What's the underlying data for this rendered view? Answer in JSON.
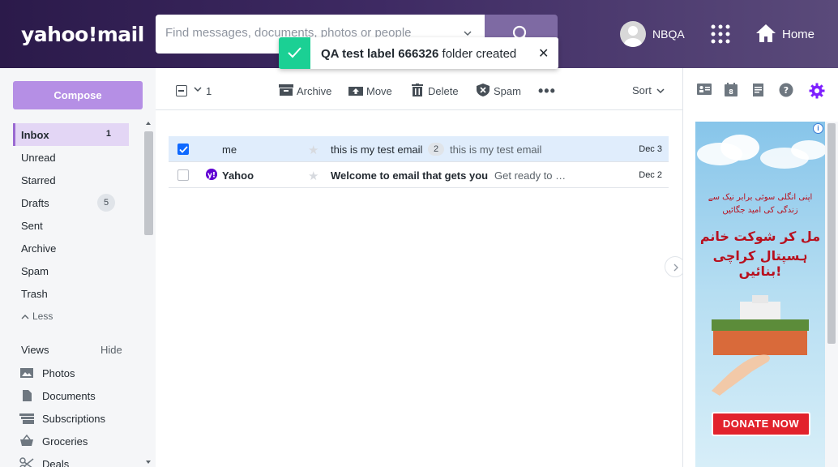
{
  "header": {
    "logo": "yahoo!mail",
    "search_placeholder": "Find messages, documents, photos or people",
    "user_name": "NBQA",
    "home_label": "Home"
  },
  "toast": {
    "label_bold": "QA test label 666326",
    "message": " folder created",
    "close": "✕"
  },
  "sidebar": {
    "compose": "Compose",
    "folders": [
      {
        "label": "Inbox",
        "count": "1"
      },
      {
        "label": "Unread"
      },
      {
        "label": "Starred"
      },
      {
        "label": "Drafts",
        "badge": "5"
      },
      {
        "label": "Sent"
      },
      {
        "label": "Archive"
      },
      {
        "label": "Spam"
      },
      {
        "label": "Trash"
      }
    ],
    "less": "Less",
    "views_label": "Views",
    "hide_label": "Hide",
    "views": [
      {
        "label": "Photos",
        "icon": "photo-icon"
      },
      {
        "label": "Documents",
        "icon": "document-icon"
      },
      {
        "label": "Subscriptions",
        "icon": "subscriptions-icon"
      },
      {
        "label": "Groceries",
        "icon": "basket-icon"
      },
      {
        "label": "Deals",
        "icon": "scissors-icon"
      }
    ]
  },
  "toolbar": {
    "selected_count": "1",
    "archive": "Archive",
    "move": "Move",
    "delete": "Delete",
    "spam": "Spam",
    "more": "•••",
    "sort": "Sort"
  },
  "messages": [
    {
      "sender": "me",
      "subject": "this is my test email",
      "thread_count": "2",
      "snippet": "this is my test email",
      "date": "Dec 3",
      "selected": true,
      "unread": false
    },
    {
      "sender": "Yahoo",
      "subject": "Welcome to email that gets you",
      "snippet": "Get ready to …",
      "date": "Dec 2",
      "selected": false,
      "unread": true
    }
  ],
  "ad": {
    "line1": "اپنی انگلی سوئی برابر نیک سے",
    "line2": "زندگی کی امید جگائیں",
    "line3": "مل کر شوکت خانم",
    "line4": "ہسپتال کراچی بنائیں!",
    "donate": "DONATE NOW",
    "info": "i"
  },
  "colors": {
    "accent": "#7e1fff",
    "compose": "#b58fe5",
    "toast_success": "#1bd094",
    "selected_row": "#e0edfc"
  }
}
